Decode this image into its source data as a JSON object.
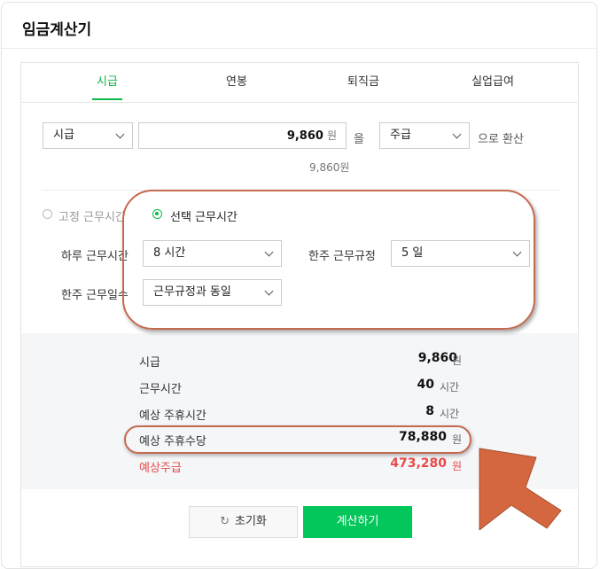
{
  "card": {
    "title": "임금계산기"
  },
  "tabs": [
    {
      "label": "시급"
    },
    {
      "label": "연봉"
    },
    {
      "label": "퇴직금"
    },
    {
      "label": "실업급여"
    }
  ],
  "convert": {
    "from_unit": "시급",
    "amount": "9,860",
    "amount_unit": "원",
    "particle": "을",
    "to_unit": "주급",
    "suffix": "으로 환산",
    "amount_hint": "9,860원"
  },
  "work": {
    "fixed_label": "고정 근무시간",
    "custom_label": "선택 근무시간",
    "daily_label": "하루 근무시간",
    "daily_value": "8 시간",
    "weekly_rule_label": "한주 근무규정",
    "weekly_rule_value": "5 일",
    "weekly_days_label": "한주 근무일수",
    "weekly_days_value": "근무규정과 동일"
  },
  "results": [
    {
      "label": "시급",
      "value": "9,860",
      "unit": "원"
    },
    {
      "label": "근무시간",
      "value": "40",
      "unit": "시간"
    },
    {
      "label": "예상 주휴시간",
      "value": "8",
      "unit": "시간"
    },
    {
      "label": "예상 주휴수당",
      "value": "78,880",
      "unit": "원"
    },
    {
      "label": "예상주급",
      "value": "473,280",
      "unit": "원"
    }
  ],
  "buttons": {
    "reset": "초기화",
    "calculate": "계산하기"
  },
  "colors": {
    "accent": "#03c75a",
    "highlight": "#e84a4a",
    "annotation": "#c56a4f"
  }
}
